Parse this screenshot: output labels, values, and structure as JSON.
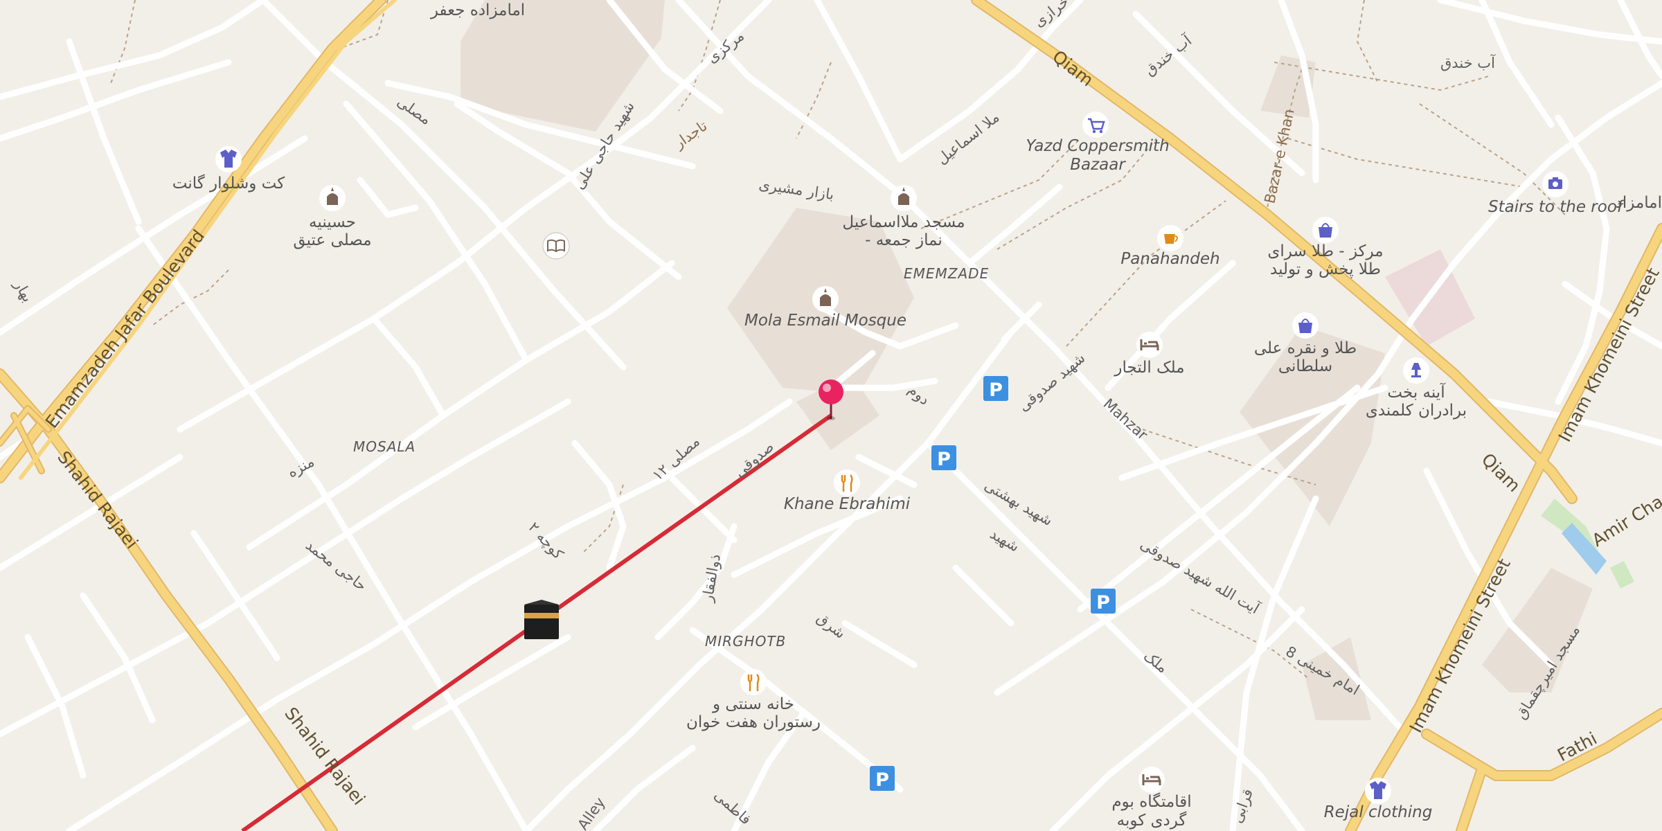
{
  "map": {
    "colors": {
      "background": "#f2efe9",
      "minor_road": "#ffffff",
      "major_road": "#f7d57f",
      "major_road_casing": "#e2b766",
      "building_block": "#e7dfd6",
      "route_line": "#d62b36",
      "pin": "#e8235f",
      "parking": "#3d8fe0",
      "poi_purple": "#5b5fc7",
      "poi_brown": "#7b6456",
      "poi_orange": "#e08b18",
      "water": "#9fcbec",
      "park": "#cfe8c2"
    },
    "area_labels": [
      "MOSALA",
      "EMEMZADE",
      "MIRGHOTB"
    ],
    "major_streets": [
      "Emamzadeh Jafar Boulevard",
      "Shahid Rajaei",
      "Shahid Rajaei",
      "Qiam",
      "Qiam",
      "Imam Khomeini Street",
      "Imam Khomeini Street",
      "Amir Cha",
      "Fathi"
    ],
    "streets": {
      "mahzar": "Mahzar",
      "alley": "Alley",
      "bazar_e_khan": "Bazar-e Khan"
    },
    "pois": {
      "kot_shalvar": "کت وشلوار گانت",
      "hosseinieh": "حسینیه\nمصلی عتیق",
      "emamzadeh_jafar": "امامزاده جعفر",
      "masjed_mola": "مسجد ملااسماعیل\n- نماز جمعه",
      "mola_esmail": "Mola Esmail Mosque",
      "yazd_coppersmith": "Yazd Coppersmith\nBazaar",
      "panahandeh": "Panahandeh",
      "markaz_tala": "مرکز - طلا سرای\nطلا پخش و تولید",
      "stairs": "Stairs to the roof",
      "emamzadeh_partial": "امامزاد",
      "molk_tojjar": "ملک التجار",
      "tala_noghre": "طلا و نقره علی\nسلطانی",
      "ayene_bakht": "آینه بخت\nبرادران کلمندی",
      "khane_ebrahimi": "Khane Ebrahimi",
      "khane_sonati": "خانه سنتی و\nرستوران هفت خوان",
      "eghamatgah": "اقامتگاه بوم\nگردی کوبه",
      "rejal_clothing": "Rejal clothing",
      "ab_khandagh": "آب خندق"
    },
    "persian_streets": {
      "s1": "بازار مشیری",
      "s2": "شهید حاجی علی",
      "s3": "مصلی",
      "s4": "ملا اسماعیل",
      "s5": "آب خندق",
      "s6": "مرکزی",
      "s7": "خرازی",
      "s8": "مصلی ۱۲",
      "s9": "صدوقی",
      "s10": "شهید صدوقی",
      "s11": "آیت الله شهید صدوقی",
      "s12": "امام خمینی 8",
      "s13": "ملک",
      "s14": "ذوالفقار",
      "s15": "منزه",
      "s16": "حاجی محمد",
      "s17": "شهید بهشتی",
      "s18": "شرق",
      "s19": "کوچه ۲",
      "s20": "قرابی",
      "s21": "دوم",
      "s22": "فاطمی",
      "s23": "شهید",
      "s24": "تاجدار",
      "s25": "بهار",
      "s26": "مسجد امیرچقماق"
    }
  }
}
